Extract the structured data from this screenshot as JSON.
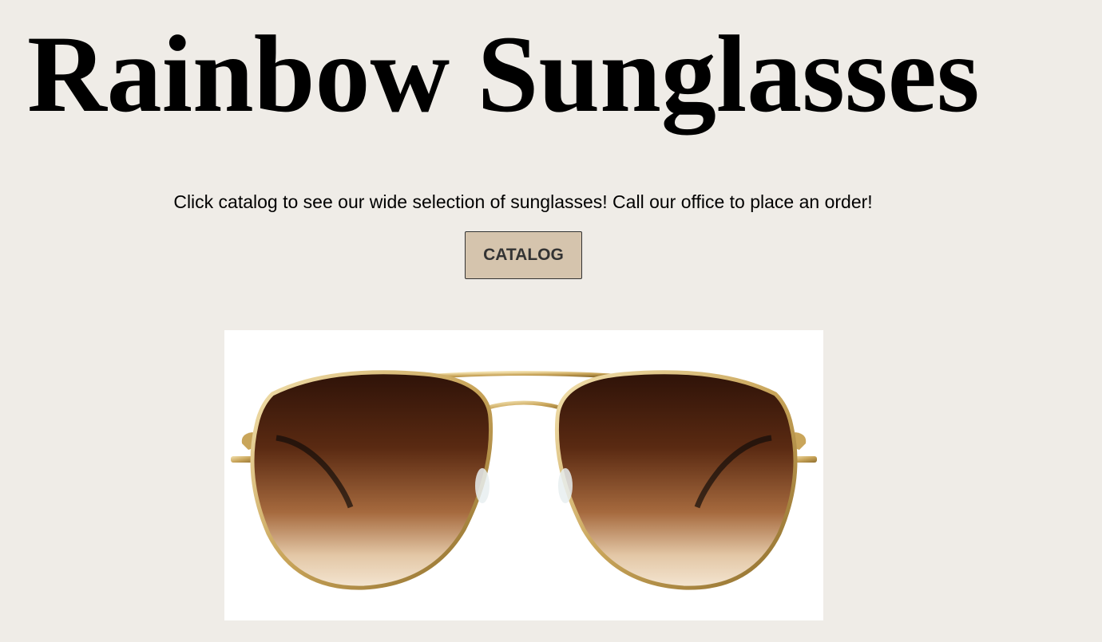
{
  "header": {
    "title": "Rainbow Sunglasses"
  },
  "main": {
    "tagline": "Click catalog to see our wide selection of sunglasses! Call our office to place an order!",
    "catalog_button_label": "CATALOG",
    "image": {
      "icon": "aviator-sunglasses-photo"
    }
  },
  "colors": {
    "background": "#efece7",
    "button_background": "#d5c4ad",
    "button_text": "#333333",
    "title_text": "#000000"
  }
}
